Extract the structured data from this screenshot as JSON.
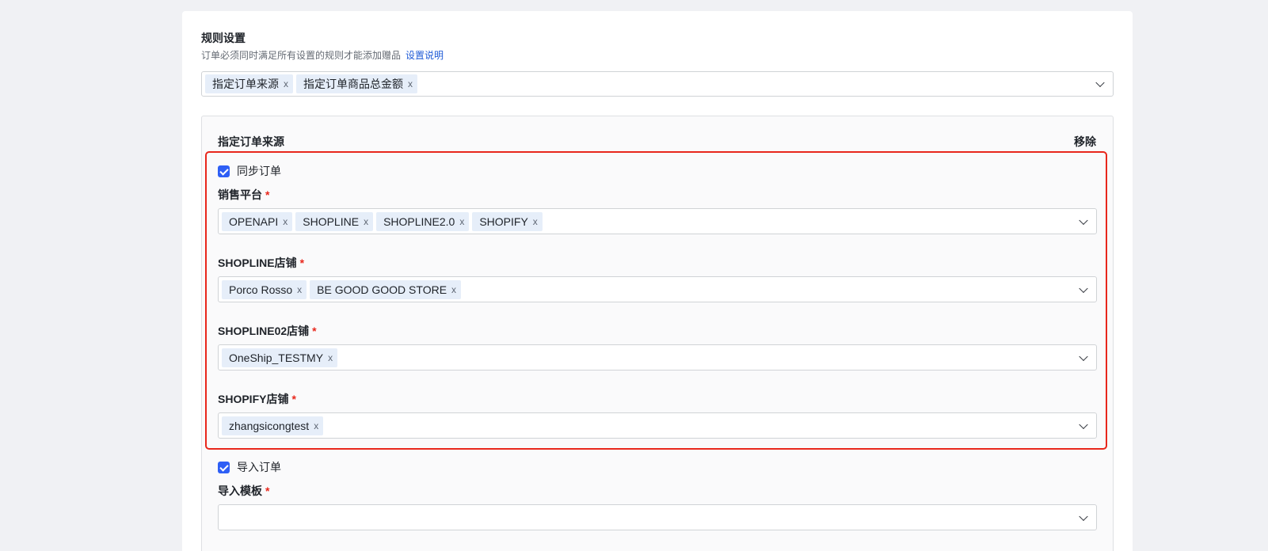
{
  "rules": {
    "title": "规则设置",
    "description": "订单必须同时满足所有设置的规则才能添加赠品",
    "help_link": "设置说明",
    "selected_rules": [
      "指定订单来源",
      "指定订单商品总金额"
    ]
  },
  "order_source": {
    "title": "指定订单来源",
    "remove_label": "移除",
    "sync_orders": {
      "label": "同步订单",
      "checked": true,
      "platform": {
        "label": "销售平台",
        "required_mark": "*",
        "tags": [
          "OPENAPI",
          "SHOPLINE",
          "SHOPLINE2.0",
          "SHOPIFY"
        ]
      },
      "shopline_store": {
        "label": "SHOPLINE店铺",
        "required_mark": "*",
        "tags": [
          "Porco Rosso",
          "BE GOOD GOOD STORE"
        ]
      },
      "shopline02_store": {
        "label": "SHOPLINE02店铺",
        "required_mark": "*",
        "tags": [
          "OneShip_TESTMY"
        ]
      },
      "shopify_store": {
        "label": "SHOPIFY店铺",
        "required_mark": "*",
        "tags": [
          "zhangsicongtest"
        ]
      }
    },
    "import_orders": {
      "label": "导入订单",
      "checked": true,
      "template": {
        "label": "导入模板",
        "required_mark": "*",
        "tags": []
      }
    }
  },
  "tag_remove_glyph": "x",
  "colors": {
    "accent": "#2e5ff5",
    "link": "#1f5bd6",
    "required": "#e8271c",
    "highlight_border": "#e8271c",
    "tag_bg": "#e6eef9"
  },
  "icons": {
    "checkbox": "checkbox-checked-icon",
    "dropdown": "chevron-down-icon",
    "tag_close": "close-icon"
  }
}
